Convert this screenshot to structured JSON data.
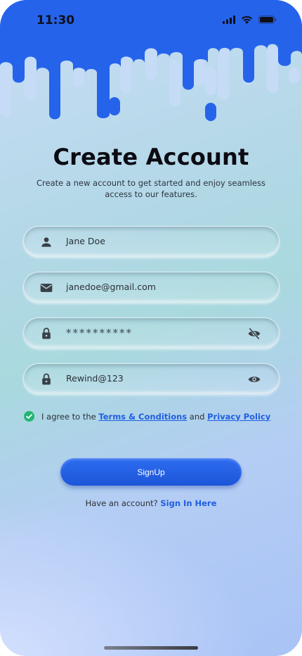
{
  "status_bar": {
    "time": "11:30"
  },
  "header": {
    "title": "Create Account",
    "subtitle": "Create a new account to get started and enjoy seamless access to our features."
  },
  "form": {
    "name_value": "Jane Doe",
    "email_value": "janedoe@gmail.com",
    "password_value": "**********",
    "confirm_password_value": "Rewind@123"
  },
  "agreement": {
    "prefix": "I agree to the ",
    "terms_link": "Terms & Conditions",
    "middle": " and ",
    "privacy_link": "Privacy Policy"
  },
  "signup_button": "SignUp",
  "footer": {
    "question": "Have an account? ",
    "link": "Sign In Here"
  },
  "colors": {
    "accent": "#2563eb",
    "check": "#22b573"
  },
  "icons": [
    "person-icon",
    "mail-icon",
    "lock-icon",
    "eye-off-icon",
    "eye-icon",
    "check-circle-icon",
    "signal-icon",
    "wifi-icon",
    "battery-icon"
  ]
}
